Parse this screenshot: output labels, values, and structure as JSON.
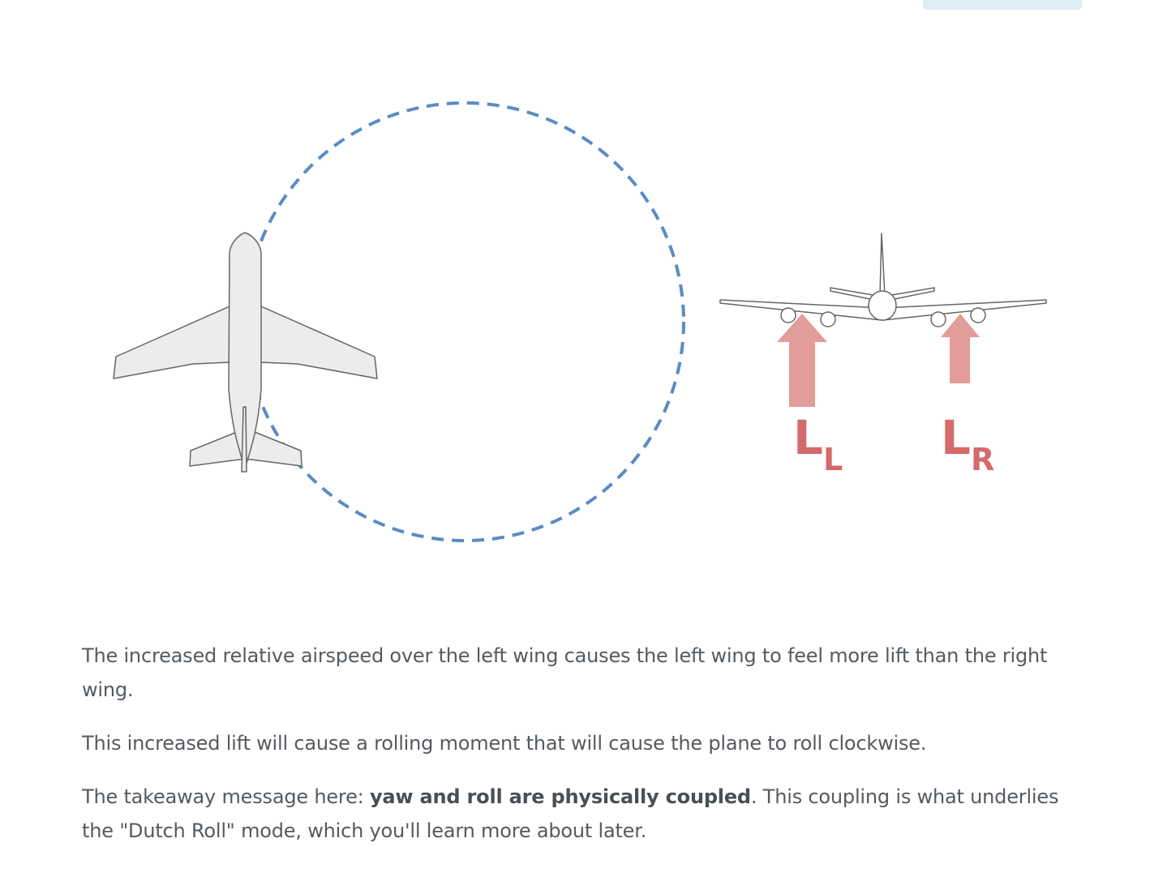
{
  "diagram": {
    "lift_left_label": "L",
    "lift_left_subscript": "L",
    "lift_right_label": "L",
    "lift_right_subscript": "R",
    "colors": {
      "dashed_circle": "#5a8cc4",
      "lift_arrow": "#e29c9a",
      "lift_label": "#d46a6a",
      "plane_fill": "#ececec",
      "plane_stroke": "#666666"
    }
  },
  "content": {
    "paragraph1": "The increased relative airspeed over the left wing causes the left wing to feel more lift than the right wing.",
    "paragraph2": "This increased lift will cause a rolling moment that will cause the plane to roll clockwise.",
    "paragraph3_prefix": "The takeaway message here: ",
    "paragraph3_bold": "yaw and roll are physically coupled",
    "paragraph3_suffix": ". This coupling is what underlies the \"Dutch Roll\" mode, which you'll learn more about later."
  }
}
